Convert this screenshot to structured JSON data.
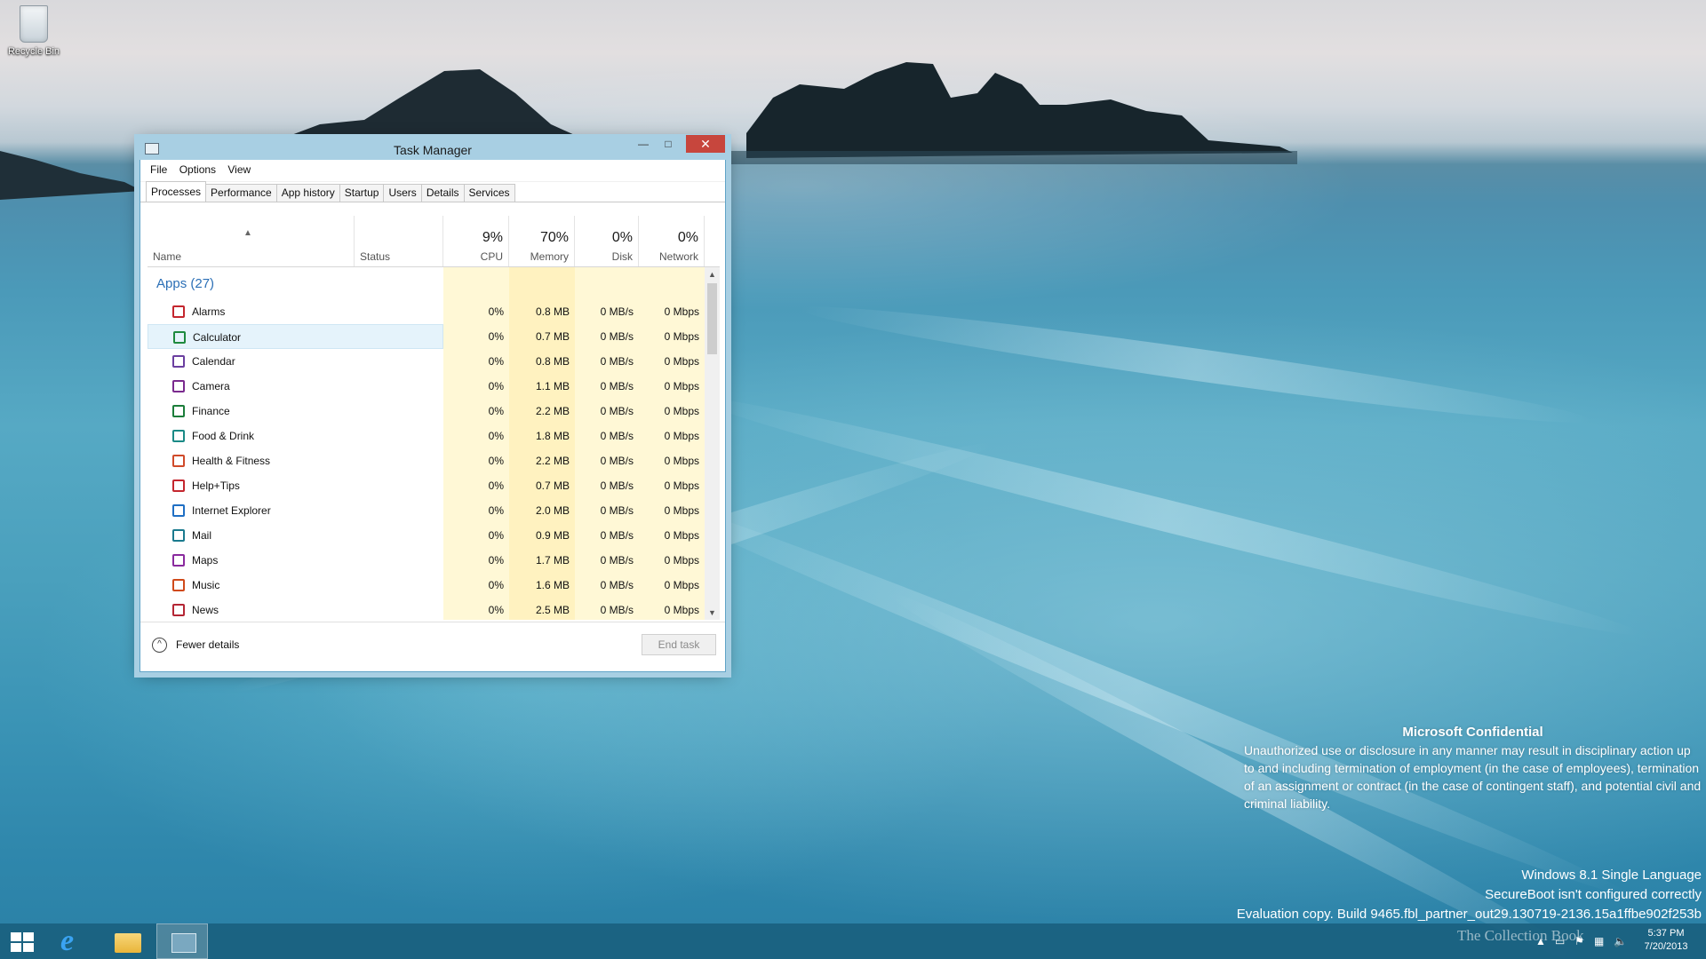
{
  "desktop": {
    "recycle_bin_label": "Recycle Bin"
  },
  "window": {
    "title": "Task Manager",
    "menu": [
      "File",
      "Options",
      "View"
    ],
    "tabs": [
      "Processes",
      "Performance",
      "App history",
      "Startup",
      "Users",
      "Details",
      "Services"
    ],
    "active_tab": "Processes",
    "columns": {
      "name": "Name",
      "status": "Status",
      "cpu": {
        "pct": "9%",
        "label": "CPU"
      },
      "memory": {
        "pct": "70%",
        "label": "Memory"
      },
      "disk": {
        "pct": "0%",
        "label": "Disk"
      },
      "network": {
        "pct": "0%",
        "label": "Network"
      }
    },
    "group_label": "Apps (27)",
    "rows": [
      {
        "name": "Alarms",
        "cpu": "0%",
        "memory": "0.8 MB",
        "disk": "0 MB/s",
        "network": "0 Mbps",
        "icon": "alarms-icon",
        "color": "#c4262e"
      },
      {
        "name": "Calculator",
        "cpu": "0%",
        "memory": "0.7 MB",
        "disk": "0 MB/s",
        "network": "0 Mbps",
        "icon": "calculator-icon",
        "color": "#1e8a3e"
      },
      {
        "name": "Calendar",
        "cpu": "0%",
        "memory": "0.8 MB",
        "disk": "0 MB/s",
        "network": "0 Mbps",
        "icon": "calendar-icon",
        "color": "#6b3fa0"
      },
      {
        "name": "Camera",
        "cpu": "0%",
        "memory": "1.1 MB",
        "disk": "0 MB/s",
        "network": "0 Mbps",
        "icon": "camera-icon",
        "color": "#7a2a8e"
      },
      {
        "name": "Finance",
        "cpu": "0%",
        "memory": "2.2 MB",
        "disk": "0 MB/s",
        "network": "0 Mbps",
        "icon": "finance-icon",
        "color": "#1b7d3a"
      },
      {
        "name": "Food & Drink",
        "cpu": "0%",
        "memory": "1.8 MB",
        "disk": "0 MB/s",
        "network": "0 Mbps",
        "icon": "food-drink-icon",
        "color": "#1a8a86"
      },
      {
        "name": "Health & Fitness",
        "cpu": "0%",
        "memory": "2.2 MB",
        "disk": "0 MB/s",
        "network": "0 Mbps",
        "icon": "health-fitness-icon",
        "color": "#d04a2a"
      },
      {
        "name": "Help+Tips",
        "cpu": "0%",
        "memory": "0.7 MB",
        "disk": "0 MB/s",
        "network": "0 Mbps",
        "icon": "help-tips-icon",
        "color": "#c4262e"
      },
      {
        "name": "Internet Explorer",
        "cpu": "0%",
        "memory": "2.0 MB",
        "disk": "0 MB/s",
        "network": "0 Mbps",
        "icon": "internet-explorer-icon",
        "color": "#1f6fc4"
      },
      {
        "name": "Mail",
        "cpu": "0%",
        "memory": "0.9 MB",
        "disk": "0 MB/s",
        "network": "0 Mbps",
        "icon": "mail-icon",
        "color": "#1a7a8e"
      },
      {
        "name": "Maps",
        "cpu": "0%",
        "memory": "1.7 MB",
        "disk": "0 MB/s",
        "network": "0 Mbps",
        "icon": "maps-icon",
        "color": "#8a2a9e"
      },
      {
        "name": "Music",
        "cpu": "0%",
        "memory": "1.6 MB",
        "disk": "0 MB/s",
        "network": "0 Mbps",
        "icon": "music-icon",
        "color": "#d04a1a"
      },
      {
        "name": "News",
        "cpu": "0%",
        "memory": "2.5 MB",
        "disk": "0 MB/s",
        "network": "0 Mbps",
        "icon": "news-icon",
        "color": "#b42634"
      }
    ],
    "selected_row": "Calculator",
    "footer": {
      "fewer_details": "Fewer details",
      "end_task": "End task"
    }
  },
  "watermark": {
    "heading": "Microsoft Confidential",
    "body": "Unauthorized use or disclosure in any manner may result in disciplinary action up to and including termination of employment (in the case of employees), termination of an assignment or contract (in the case of contingent staff), and potential civil and criminal liability.",
    "build_line1": "Windows 8.1 Single Language",
    "build_line2": "SecureBoot isn't configured correctly",
    "build_line3": "Evaluation copy. Build 9465.fbl_partner_out29.130719-2136.15a1ffbe902f253b"
  },
  "taskbar": {
    "pinned": [
      "start-button",
      "internet-explorer",
      "file-explorer",
      "task-manager"
    ],
    "clock_time": "5:37 PM",
    "clock_date": "7/20/2013",
    "overlay_text": "The Collection Book"
  }
}
